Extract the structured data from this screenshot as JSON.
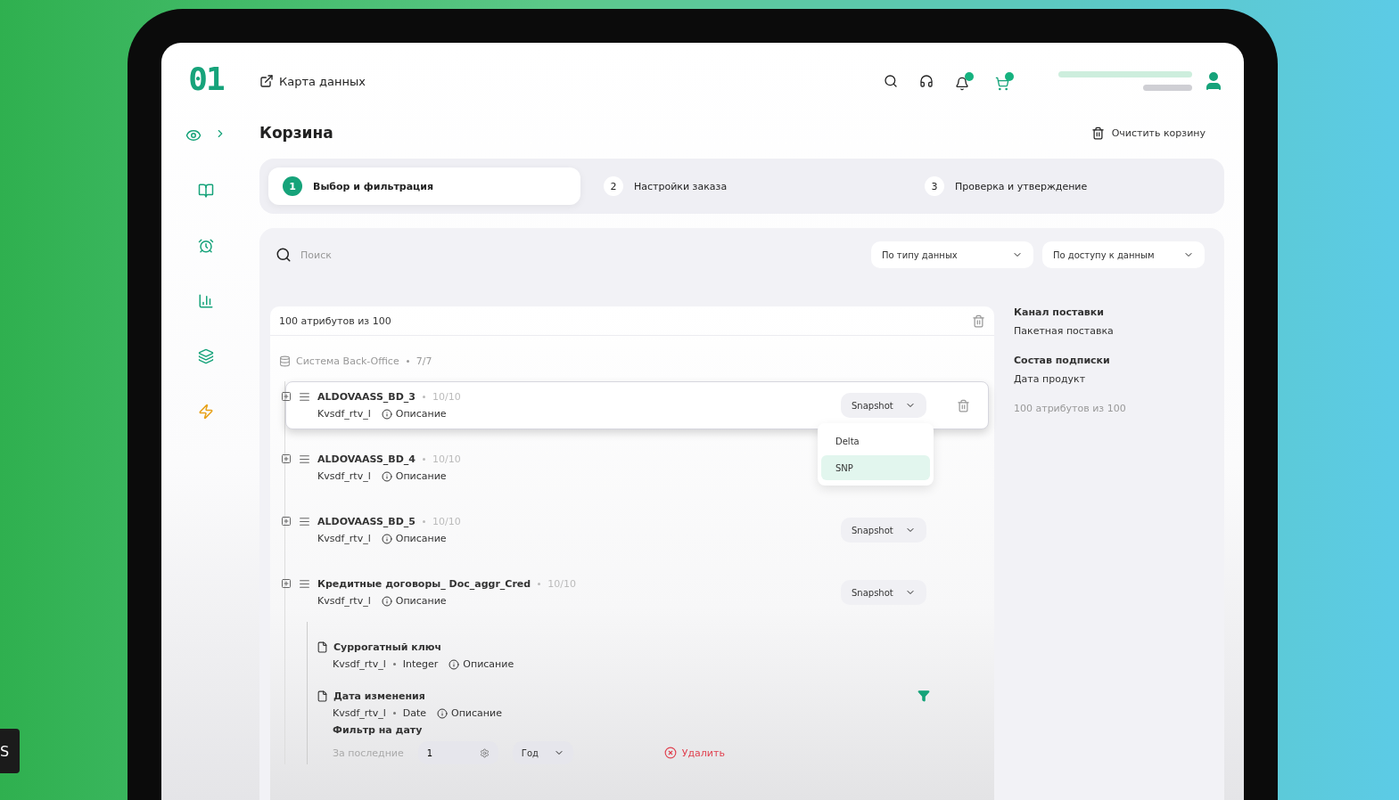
{
  "logo": "01",
  "map_link": "Карта данных",
  "page_title": "Корзина",
  "clear_button": "Очистить корзину",
  "steps": [
    {
      "number": "1",
      "label": "Выбор и фильтрация",
      "selected": true
    },
    {
      "number": "2",
      "label": "Настройки заказа",
      "selected": false
    },
    {
      "number": "3",
      "label": "Проверка и утверждение",
      "selected": false
    }
  ],
  "search": {
    "placeholder": "Поиск"
  },
  "filters": [
    {
      "label": "По типу данных"
    },
    {
      "label": "По доступу к данным"
    }
  ],
  "selection": {
    "summary": "100 атрибутов из 100",
    "system": {
      "name": "Система Back-Office",
      "count": "7/7"
    },
    "tables": [
      {
        "name": "ALDOVAASS_BD_3",
        "count": "10/10",
        "source": "Kvsdf_rtv_l",
        "description": "Описание",
        "mode": "Snapshot",
        "highlighted": true,
        "menu": [
          {
            "label": "Delta",
            "selected": false
          },
          {
            "label": "SNP",
            "selected": true
          }
        ]
      },
      {
        "name": "ALDOVAASS_BD_4",
        "count": "10/10",
        "source": "Kvsdf_rtv_l",
        "description": "Описание",
        "highlighted": false
      },
      {
        "name": "ALDOVAASS_BD_5",
        "count": "10/10",
        "source": "Kvsdf_rtv_l",
        "description": "Описание",
        "mode": "Snapshot",
        "highlighted": false
      },
      {
        "name": "Кредитные договоры_ Doc_aggr_Cred",
        "count": "10/10",
        "source": "Kvsdf_rtv_l",
        "description": "Описание",
        "mode": "Snapshot",
        "highlighted": false,
        "attributes": [
          {
            "name": "Суррогатный ключ",
            "source": "Kvsdf_rtv_l",
            "type": "Integer",
            "description": "Описание"
          },
          {
            "name": "Дата изменения",
            "source": "Kvsdf_rtv_l",
            "type": "Date",
            "description": "Описание",
            "filter": {
              "title": "Фильтр на дату",
              "period_label": "За последние",
              "period_value": "1",
              "unit": "Год",
              "remove": "Удалить"
            }
          }
        ]
      }
    ]
  },
  "info": [
    {
      "label": "Канал поставки",
      "value": "Пакетная поставка"
    },
    {
      "label": "Состав подписки",
      "value": "Дата продукт"
    }
  ],
  "info_footer": "100 атрибутов из 100",
  "overlay_label": "S"
}
